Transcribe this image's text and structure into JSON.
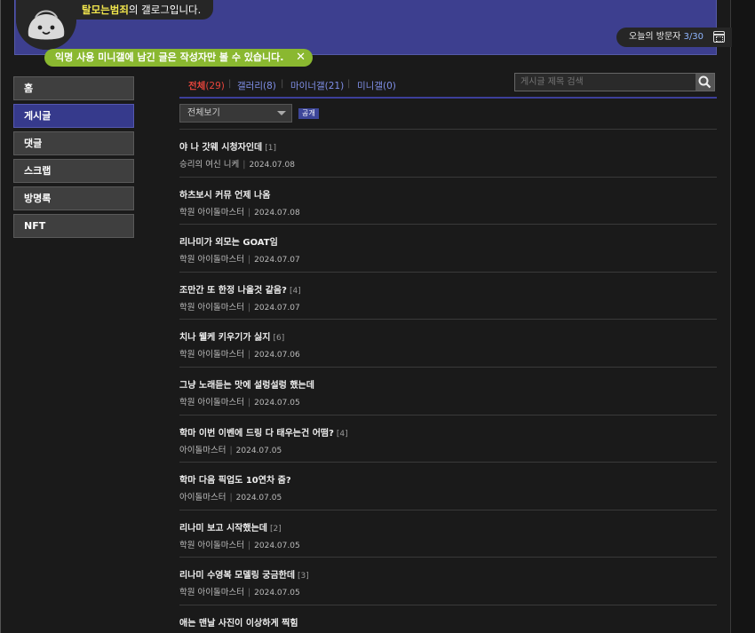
{
  "header": {
    "nickname": "탈모는범죄",
    "title_suffix": "의 갤로그입니다.",
    "visitor_label": "오늘의 방문자",
    "visitor_count": "3/30",
    "notice": "익명 사용 미니갤에 남긴 글은 작성자만 볼 수 있습니다.",
    "notice_close": "✕"
  },
  "sidebar": {
    "items": [
      {
        "label": "홈"
      },
      {
        "label": "게시글"
      },
      {
        "label": "댓글"
      },
      {
        "label": "스크랩"
      },
      {
        "label": "방명록"
      },
      {
        "label": "NFT"
      }
    ],
    "active_index": 1
  },
  "tabs": [
    {
      "label": "전체",
      "count": "(29)"
    },
    {
      "label": "갤러리",
      "count": "(8)"
    },
    {
      "label": "마이너갤",
      "count": "(21)"
    },
    {
      "label": "미니갤",
      "count": "(0)"
    }
  ],
  "search": {
    "placeholder": "게시글 제목 검색"
  },
  "filter": {
    "selected": "전체보기",
    "badge": "공개"
  },
  "posts": [
    {
      "title": "야 나 갓웨 시청자인데",
      "comments": "[1]",
      "gallery": "승리의 여신 니케",
      "date": "2024.07.08"
    },
    {
      "title": "하츠보시 커뮤 언제 나옴",
      "comments": "",
      "gallery": "학원 아이돌마스터",
      "date": "2024.07.08"
    },
    {
      "title": "리나미가 외모는 GOAT임",
      "comments": "",
      "gallery": "학원 아이돌마스터",
      "date": "2024.07.07"
    },
    {
      "title": "조만간 또 한정 나올것 같음?",
      "comments": "[4]",
      "gallery": "학원 아이돌마스터",
      "date": "2024.07.07"
    },
    {
      "title": "치나 웰케 키우기가 싫지",
      "comments": "[6]",
      "gallery": "학원 아이돌마스터",
      "date": "2024.07.06"
    },
    {
      "title": "그냥 노래듣는 맛에 설렁설렁 했는데",
      "comments": "",
      "gallery": "학원 아이돌마스터",
      "date": "2024.07.05"
    },
    {
      "title": "학마 이번 이벤에 드링 다 태우는건 어떰?",
      "comments": "[4]",
      "gallery": "아이돌마스터",
      "date": "2024.07.05"
    },
    {
      "title": "학마 다음 픽업도 10연차 줌?",
      "comments": "",
      "gallery": "아이돌마스터",
      "date": "2024.07.05"
    },
    {
      "title": "리나미 보고 시작했는데",
      "comments": "[2]",
      "gallery": "학원 아이돌마스터",
      "date": "2024.07.05"
    },
    {
      "title": "리나미 수영복 모델링 궁금한데",
      "comments": "[3]",
      "gallery": "학원 아이돌마스터",
      "date": "2024.07.05"
    },
    {
      "title": "애는 맨날 사진이 이상하게 찍힘",
      "comments": "",
      "gallery": "",
      "date": ""
    }
  ],
  "colors": {
    "header_bg": "#3d3f8f",
    "accent": "#3c3f9a",
    "active_tab": "#e8453c",
    "tab_link": "#7f8fe8",
    "notice_bg": "#8ab830",
    "nickname": "#f2e64d"
  },
  "icons": {
    "calendar": "calendar-icon",
    "search": "search-icon",
    "close": "close-icon",
    "dropdown": "chevron-down-icon"
  }
}
